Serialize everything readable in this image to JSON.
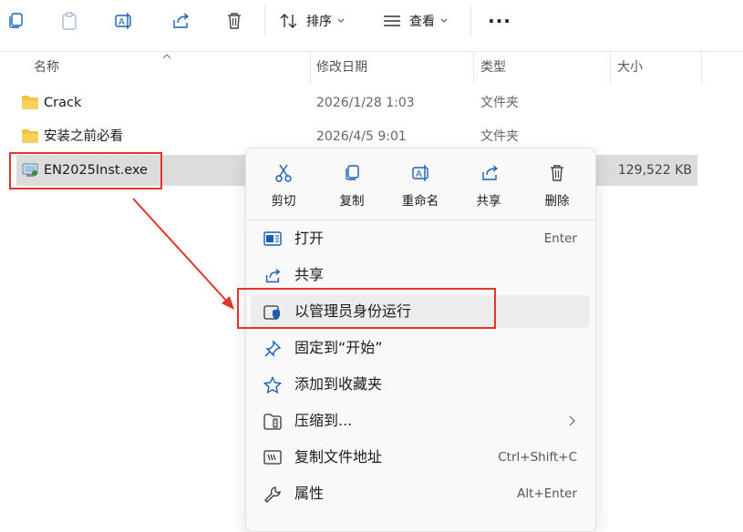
{
  "toolbar": {
    "sort_label": "排序",
    "view_label": "查看",
    "more_label": "···"
  },
  "columns": {
    "name": "名称",
    "modified": "修改日期",
    "type": "类型",
    "size": "大小"
  },
  "files": [
    {
      "name": "Crack",
      "date": "2026/1/28 1:03",
      "type": "文件夹",
      "size": ""
    },
    {
      "name": "安装之前必看",
      "date": "2026/4/5 9:01",
      "type": "文件夹",
      "size": ""
    },
    {
      "name": "EN2025Inst.exe",
      "date": "",
      "type": "",
      "size": "129,522 KB"
    }
  ],
  "context_menu": {
    "quick_actions": [
      {
        "label": "剪切"
      },
      {
        "label": "复制"
      },
      {
        "label": "重命名"
      },
      {
        "label": "共享"
      },
      {
        "label": "删除"
      }
    ],
    "items": [
      {
        "label": "打开",
        "shortcut": "Enter"
      },
      {
        "label": "共享",
        "shortcut": ""
      },
      {
        "label": "以管理员身份运行",
        "shortcut": ""
      },
      {
        "label": "固定到“开始”",
        "shortcut": ""
      },
      {
        "label": "添加到收藏夹",
        "shortcut": ""
      },
      {
        "label": "压缩到...",
        "shortcut": ""
      },
      {
        "label": "复制文件地址",
        "shortcut": "Ctrl+Shift+C"
      },
      {
        "label": "属性",
        "shortcut": "Alt+Enter"
      }
    ]
  },
  "colors": {
    "annotation": "#e0352b",
    "accent": "#1a5fb4",
    "folder": "#f4c23d"
  }
}
